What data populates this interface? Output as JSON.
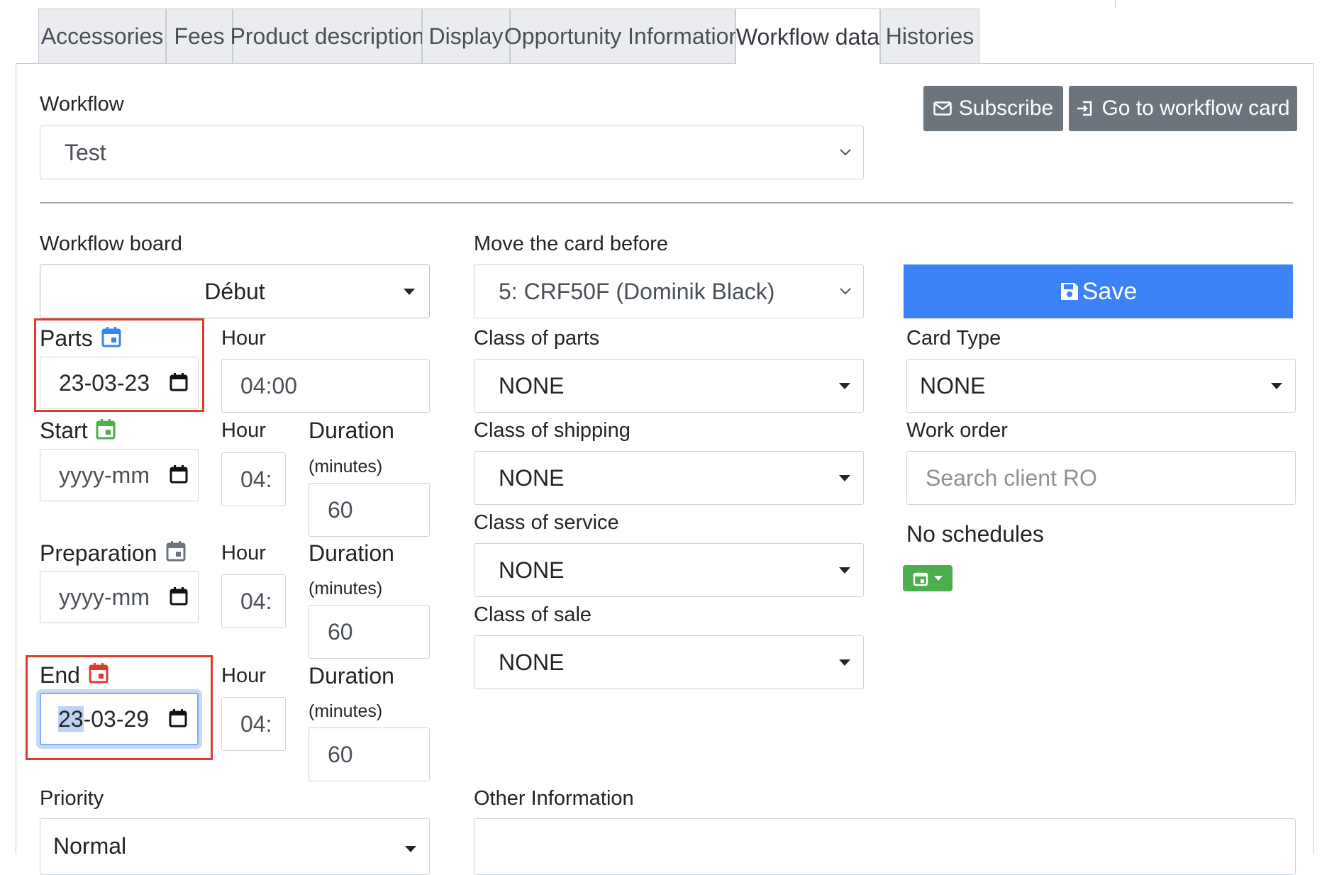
{
  "tabs": [
    "Accessories",
    "Fees",
    "Product description",
    "Display",
    "Opportunity Information",
    "Workflow data",
    "Histories"
  ],
  "active_tab": "Workflow data",
  "workflow": {
    "label": "Workflow",
    "value": "Test"
  },
  "buttons": {
    "subscribe": "Subscribe",
    "go_to_card": "Go to workflow card",
    "save": "Save"
  },
  "workflow_board": {
    "label": "Workflow board",
    "value": "Début"
  },
  "move_card": {
    "label": "Move the card before",
    "value": "5: CRF50F (Dominik Black)"
  },
  "parts": {
    "label": "Parts",
    "date": "23-03-23",
    "hour_label": "Hour",
    "hour": "04:00"
  },
  "start": {
    "label": "Start",
    "date": "yyyy-mm",
    "hour_label": "Hour",
    "hour": "04:",
    "duration_label": "Duration",
    "duration_unit": "(minutes)",
    "duration": "60"
  },
  "preparation": {
    "label": "Preparation",
    "date": "yyyy-mm",
    "hour_label": "Hour",
    "hour": "04:",
    "duration_label": "Duration",
    "duration_unit": "(minutes)",
    "duration": "60"
  },
  "end": {
    "label": "End",
    "date_sel": "23",
    "date_rest": "-03-29",
    "hour_label": "Hour",
    "hour": "04:",
    "duration_label": "Duration",
    "duration_unit": "(minutes)",
    "duration": "60"
  },
  "class_parts": {
    "label": "Class of parts",
    "value": "NONE"
  },
  "class_shipping": {
    "label": "Class of shipping",
    "value": "NONE"
  },
  "class_service": {
    "label": "Class of service",
    "value": "NONE"
  },
  "class_sale": {
    "label": "Class of sale",
    "value": "NONE"
  },
  "card_type": {
    "label": "Card Type",
    "value": "NONE"
  },
  "work_order": {
    "label": "Work order",
    "placeholder": "Search client RO"
  },
  "schedules": {
    "text": "No schedules"
  },
  "priority": {
    "label": "Priority",
    "value": "Normal"
  },
  "other_info": {
    "label": "Other Information"
  },
  "colors": {
    "accent": "#3b82f6",
    "grey_button": "#6c757d",
    "highlight": "#dc3a2d",
    "parts_icon": "#3b82f6",
    "start_icon": "#4cae4c",
    "end_icon": "#dc3a2d",
    "prep_icon": "#6c757d"
  }
}
